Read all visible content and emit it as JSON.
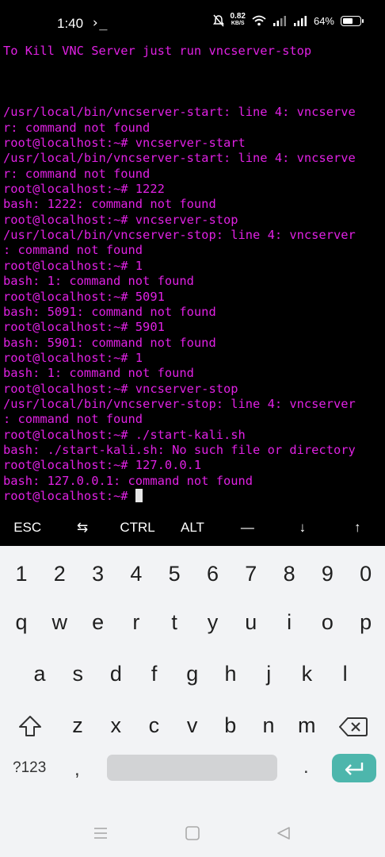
{
  "status": {
    "time": "1:40",
    "app_indicator": "›_",
    "net_speed_value": "0.82",
    "net_speed_unit": "KB/S",
    "battery": "64%",
    "battery_level": 0.64
  },
  "terminal": {
    "lines": [
      "To Kill VNC Server just run vncserver-stop",
      "",
      "",
      "",
      "/usr/local/bin/vncserver-start: line 4: vncserve",
      "r: command not found",
      "root@localhost:~# vncserver-start",
      "/usr/local/bin/vncserver-start: line 4: vncserve",
      "r: command not found",
      "root@localhost:~# 1222",
      "bash: 1222: command not found",
      "root@localhost:~# vncserver-stop",
      "/usr/local/bin/vncserver-stop: line 4: vncserver",
      ": command not found",
      "root@localhost:~# 1",
      "bash: 1: command not found",
      "root@localhost:~# 5091",
      "bash: 5091: command not found",
      "root@localhost:~# 5901",
      "bash: 5901: command not found",
      "root@localhost:~# 1",
      "bash: 1: command not found",
      "root@localhost:~# vncserver-stop",
      "/usr/local/bin/vncserver-stop: line 4: vncserver",
      ": command not found",
      "root@localhost:~# ./start-kali.sh",
      "bash: ./start-kali.sh: No such file or directory",
      "root@localhost:~# 127.0.0.1",
      "bash: 127.0.0.1: command not found"
    ],
    "prompt": "root@localhost:~# "
  },
  "extra_keys": [
    "ESC",
    "⇆",
    "CTRL",
    "ALT",
    "—",
    "↓",
    "↑"
  ],
  "keyboard": {
    "numbers": [
      "1",
      "2",
      "3",
      "4",
      "5",
      "6",
      "7",
      "8",
      "9",
      "0"
    ],
    "row1": [
      "q",
      "w",
      "e",
      "r",
      "t",
      "y",
      "u",
      "i",
      "o",
      "p"
    ],
    "row2": [
      "a",
      "s",
      "d",
      "f",
      "g",
      "h",
      "j",
      "k",
      "l"
    ],
    "row3": [
      "z",
      "x",
      "c",
      "v",
      "b",
      "n",
      "m"
    ],
    "symbols_label": "?123",
    "comma": ",",
    "period": ".",
    "accent_color": "#4db6ac"
  },
  "colors": {
    "terminal_text": "#e021e3",
    "terminal_bg": "#000000",
    "keyboard_bg": "#f2f3f5"
  }
}
